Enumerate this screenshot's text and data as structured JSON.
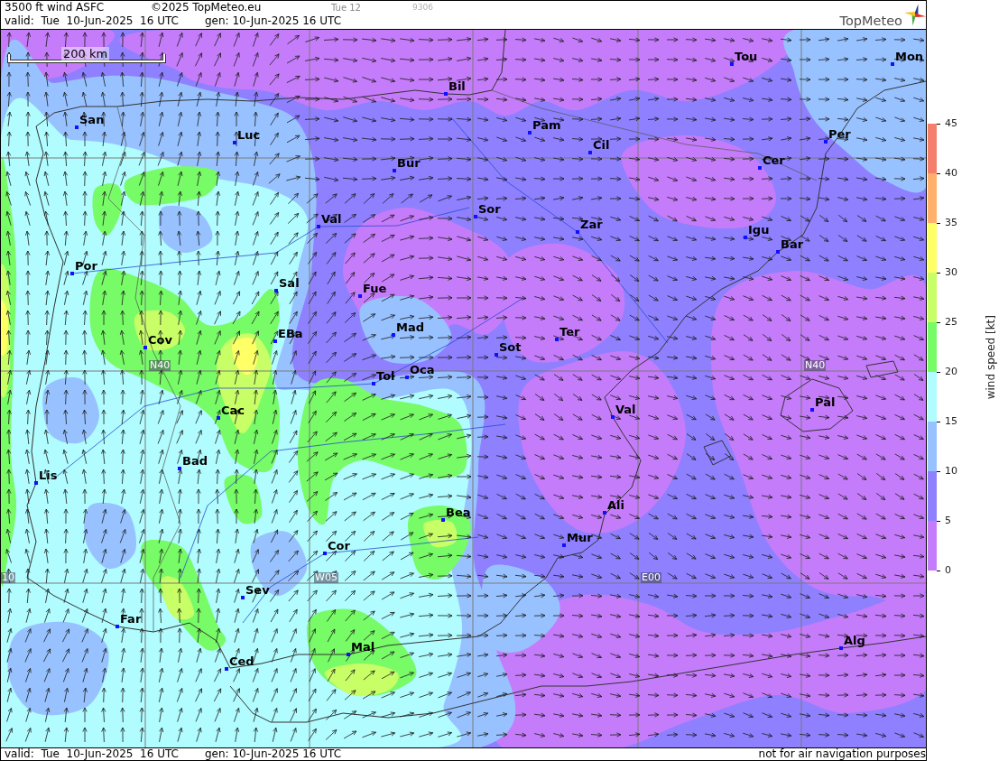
{
  "header": {
    "title": "3500 ft wind ASFC",
    "copyright": "©2025 TopMeteo.eu",
    "day_code": "Tue 12",
    "run_code": "9306",
    "valid": "valid:  Tue  10-Jun-2025  16 UTC",
    "generated": "gen: 10-Jun-2025 16 UTC",
    "logo_text": "TopMeteo"
  },
  "map": {
    "scale_label": "200 km",
    "grid_labels": [
      "N40",
      "N40",
      "10",
      "W05",
      "E00"
    ],
    "cities": [
      {
        "name": "Tou"
      },
      {
        "name": "Mon"
      },
      {
        "name": "Bil"
      },
      {
        "name": "San"
      },
      {
        "name": "Pam"
      },
      {
        "name": "Luc"
      },
      {
        "name": "Per"
      },
      {
        "name": "Cil"
      },
      {
        "name": "Cer"
      },
      {
        "name": "Bur"
      },
      {
        "name": "Sor"
      },
      {
        "name": "Val"
      },
      {
        "name": "Zar"
      },
      {
        "name": "Igu"
      },
      {
        "name": "Bar"
      },
      {
        "name": "Por"
      },
      {
        "name": "Sal"
      },
      {
        "name": "Fue"
      },
      {
        "name": "Mad"
      },
      {
        "name": "EBa"
      },
      {
        "name": "Ter"
      },
      {
        "name": "Cov"
      },
      {
        "name": "Sot"
      },
      {
        "name": "Oca"
      },
      {
        "name": "Tol"
      },
      {
        "name": "Pal"
      },
      {
        "name": "Val"
      },
      {
        "name": "Cac"
      },
      {
        "name": "Bad"
      },
      {
        "name": "Lis"
      },
      {
        "name": "Ali"
      },
      {
        "name": "Bea"
      },
      {
        "name": "Mur"
      },
      {
        "name": "Cor"
      },
      {
        "name": "Sev"
      },
      {
        "name": "Far"
      },
      {
        "name": "Alg"
      },
      {
        "name": "Mal"
      },
      {
        "name": "Ced"
      }
    ]
  },
  "legend": {
    "title": "wind speed [kt]",
    "ticks": [
      "45",
      "40",
      "35",
      "30",
      "25",
      "20",
      "15",
      "10",
      "5",
      "0"
    ],
    "bands": [
      {
        "color": "#f47f6c"
      },
      {
        "color": "#ffb06a"
      },
      {
        "color": "#ffff66"
      },
      {
        "color": "#c8ff66"
      },
      {
        "color": "#77fb66"
      },
      {
        "color": "#b0fcff"
      },
      {
        "color": "#98c2ff"
      },
      {
        "color": "#8e80ff"
      },
      {
        "color": "#c57cfa"
      }
    ]
  },
  "footer": {
    "valid": "valid:  Tue  10-Jun-2025  16 UTC",
    "generated": "gen: 10-Jun-2025 16 UTC",
    "disclaimer": "not for air navigation purposes"
  }
}
